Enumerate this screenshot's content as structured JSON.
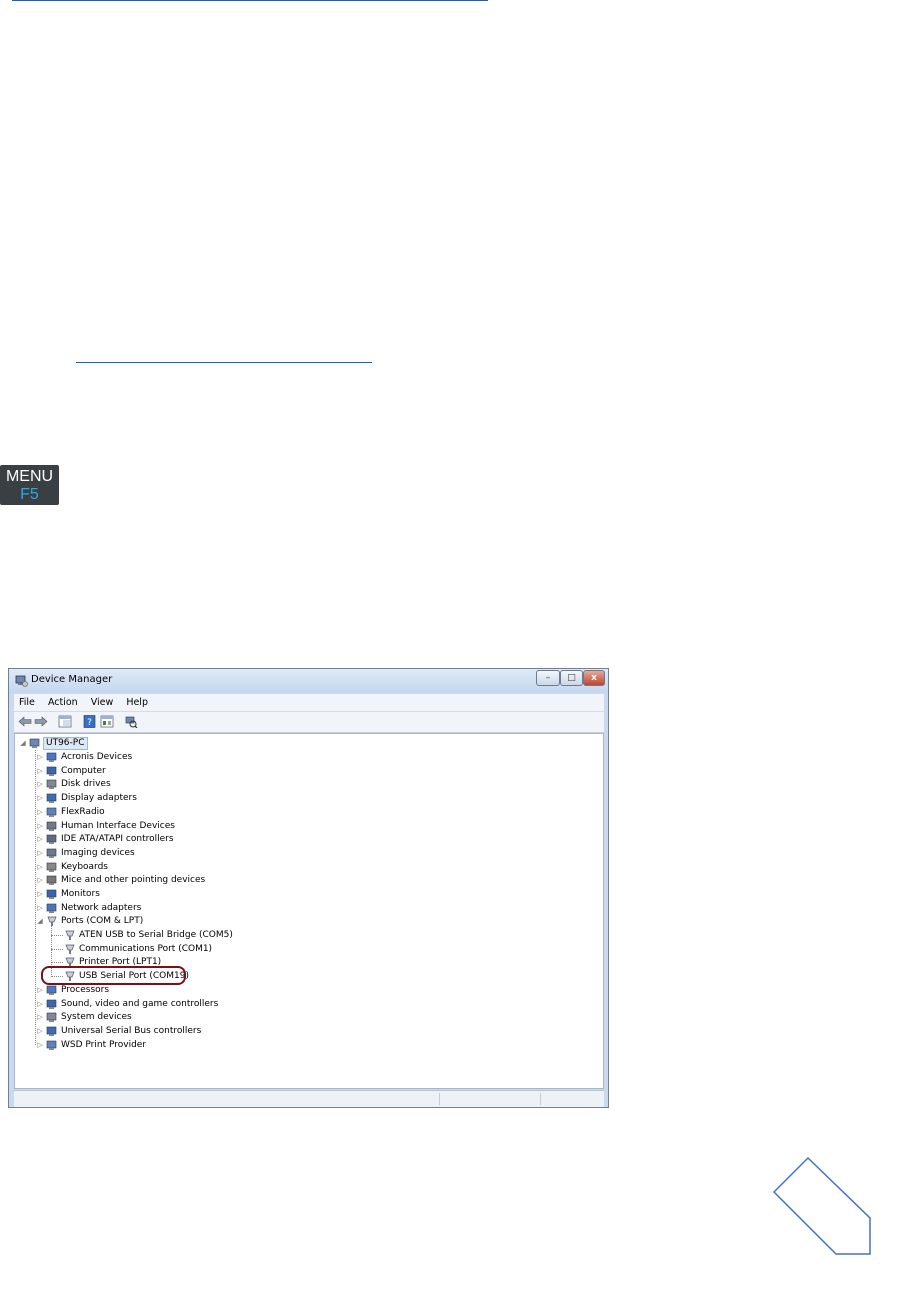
{
  "page": {
    "menu_key": {
      "line1": "MENU",
      "line2": "F5"
    }
  },
  "window": {
    "title": "Device Manager",
    "controls": {
      "minimize": "–",
      "maximize": "□",
      "close": "x"
    },
    "menu": [
      "File",
      "Action",
      "View",
      "Help"
    ],
    "toolbar_icons": [
      "back-arrow-icon",
      "forward-arrow-icon",
      "show-hide-tree-icon",
      "help-icon",
      "properties-icon",
      "scan-hardware-icon"
    ],
    "tree": {
      "root": "UT96-PC",
      "categories": [
        {
          "label": "Acronis Devices",
          "icon": "acronis-device-icon"
        },
        {
          "label": "Computer",
          "icon": "computer-icon"
        },
        {
          "label": "Disk drives",
          "icon": "disk-drive-icon"
        },
        {
          "label": "Display adapters",
          "icon": "display-adapter-icon"
        },
        {
          "label": "FlexRadio",
          "icon": "flexradio-icon"
        },
        {
          "label": "Human Interface Devices",
          "icon": "hid-icon"
        },
        {
          "label": "IDE ATA/ATAPI controllers",
          "icon": "ide-controller-icon"
        },
        {
          "label": "Imaging devices",
          "icon": "imaging-device-icon"
        },
        {
          "label": "Keyboards",
          "icon": "keyboard-icon"
        },
        {
          "label": "Mice and other pointing devices",
          "icon": "mouse-icon"
        },
        {
          "label": "Monitors",
          "icon": "monitor-icon"
        },
        {
          "label": "Network adapters",
          "icon": "network-adapter-icon"
        },
        {
          "label": "Ports (COM & LPT)",
          "icon": "port-icon",
          "expanded": true,
          "children": [
            {
              "label": "ATEN USB to Serial Bridge (COM5)",
              "icon": "port-icon"
            },
            {
              "label": "Communications Port (COM1)",
              "icon": "port-icon"
            },
            {
              "label": "Printer Port (LPT1)",
              "icon": "port-icon"
            },
            {
              "label": "USB Serial Port (COM19)",
              "icon": "port-icon",
              "highlighted": true
            }
          ]
        },
        {
          "label": "Processors",
          "icon": "processor-icon"
        },
        {
          "label": "Sound, video and game controllers",
          "icon": "sound-icon"
        },
        {
          "label": "System devices",
          "icon": "system-device-icon"
        },
        {
          "label": "Universal Serial Bus controllers",
          "icon": "usb-icon"
        },
        {
          "label": "WSD Print Provider",
          "icon": "printer-icon"
        }
      ]
    }
  },
  "colors": {
    "link": "#1f5fbf",
    "highlight_outline": "#7a1116",
    "menu_key_bg": "#3a3f44",
    "menu_key_f5": "#2ea8e6",
    "nav_shape_stroke": "#4472c4"
  }
}
